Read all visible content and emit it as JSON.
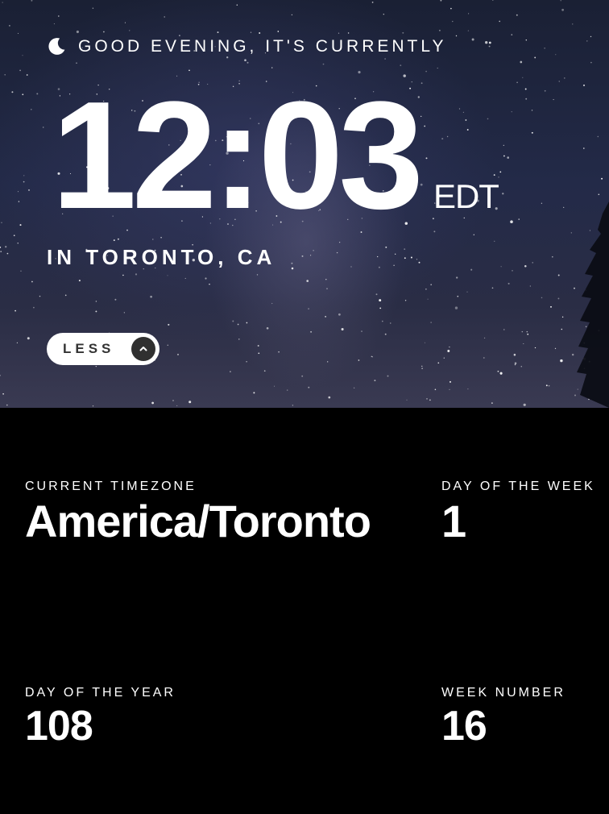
{
  "hero": {
    "greeting": "GOOD EVENING, IT'S CURRENTLY",
    "greeting_icon": "moon-icon",
    "time": "12:03",
    "timezone_abbr": "EDT",
    "location": "IN TORONTO, CA",
    "toggle_label": "LESS",
    "toggle_icon": "chevron-up-icon"
  },
  "details": {
    "timezone": {
      "label": "CURRENT TIMEZONE",
      "value": "America/Toronto"
    },
    "day_of_week": {
      "label": "DAY OF THE WEEK",
      "value": "1"
    },
    "day_of_year": {
      "label": "DAY OF THE YEAR",
      "value": "108"
    },
    "week_number": {
      "label": "WEEK NUMBER",
      "value": "16"
    }
  }
}
